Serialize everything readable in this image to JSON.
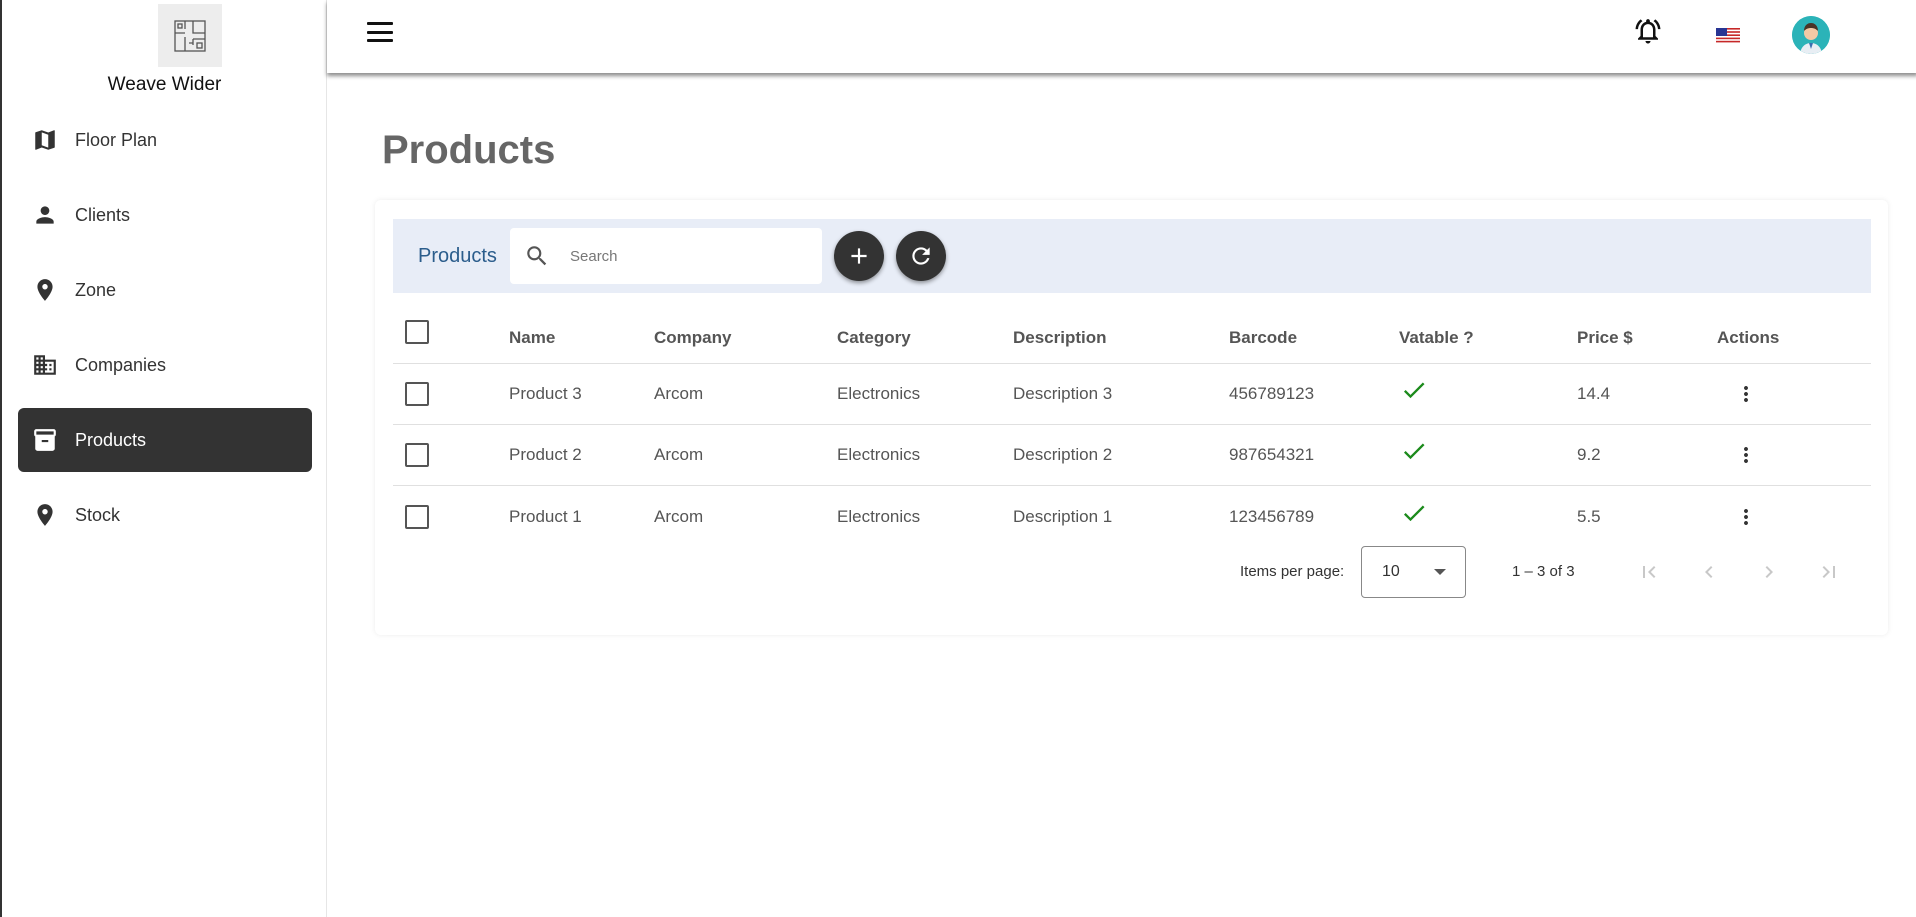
{
  "app": {
    "brand": "Weave Wider"
  },
  "sidebar": {
    "items": [
      {
        "label": "Floor Plan",
        "icon": "map-icon",
        "active": false
      },
      {
        "label": "Clients",
        "icon": "person-icon",
        "active": false
      },
      {
        "label": "Zone",
        "icon": "location-pin-icon",
        "active": false
      },
      {
        "label": "Companies",
        "icon": "building-icon",
        "active": false
      },
      {
        "label": "Products",
        "icon": "archive-box-icon",
        "active": true
      },
      {
        "label": "Stock",
        "icon": "location-pin-icon",
        "active": false
      }
    ]
  },
  "header": {
    "icons": [
      "menu-icon",
      "bell-icon",
      "us-flag-icon",
      "user-avatar"
    ]
  },
  "page": {
    "title": "Products"
  },
  "toolbar": {
    "title": "Products",
    "search_placeholder": "Search",
    "add_icon": "plus-icon",
    "refresh_icon": "refresh-icon"
  },
  "table": {
    "columns": [
      "Name",
      "Company",
      "Category",
      "Description",
      "Barcode",
      "Vatable ?",
      "Price $",
      "Actions"
    ],
    "rows": [
      {
        "name": "Product 3",
        "company": "Arcom",
        "category": "Electronics",
        "description": "Description 3",
        "barcode": "456789123",
        "vatable": true,
        "price": "14.4"
      },
      {
        "name": "Product 2",
        "company": "Arcom",
        "category": "Electronics",
        "description": "Description 2",
        "barcode": "987654321",
        "vatable": true,
        "price": "9.2"
      },
      {
        "name": "Product 1",
        "company": "Arcom",
        "category": "Electronics",
        "description": "Description 1",
        "barcode": "123456789",
        "vatable": true,
        "price": "5.5"
      }
    ]
  },
  "paginator": {
    "items_per_page_label": "Items per page:",
    "page_size": "10",
    "range_label": "1 – 3 of 3"
  },
  "colors": {
    "active_nav": "#333333",
    "toolbar_bg": "#e8edf7",
    "toolbar_title": "#2b5d8c",
    "check_green": "#1b8a1b"
  }
}
